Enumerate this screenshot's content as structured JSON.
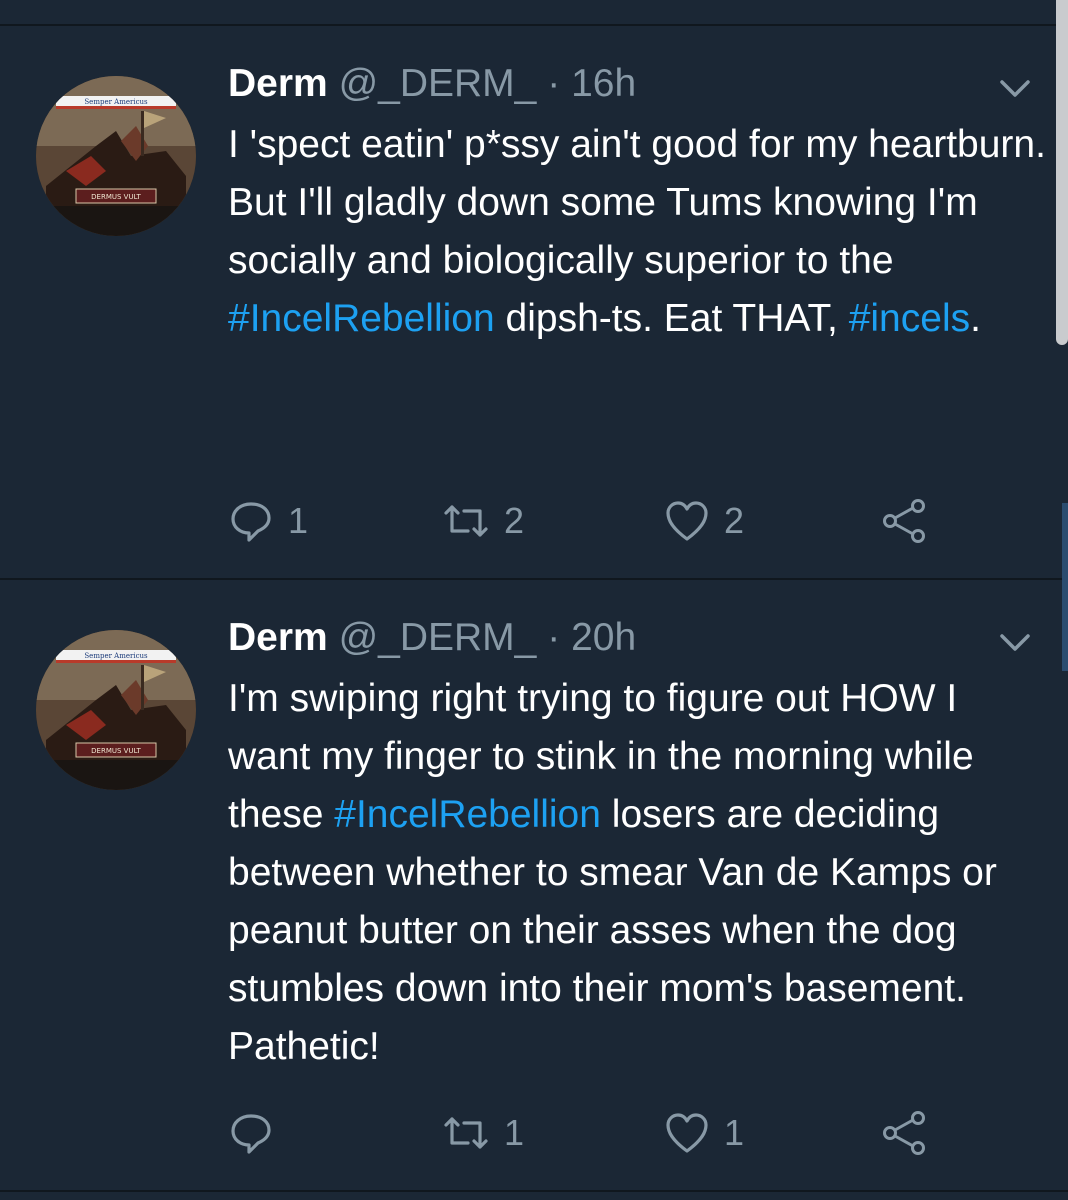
{
  "tweets": [
    {
      "display_name": "Derm",
      "handle": "@_DERM_",
      "separator": "·",
      "time": "16h",
      "avatar": {
        "top_text": "Semper Americus",
        "bottom_text": "DERMUS VULT"
      },
      "text_parts": [
        "I 'spect eatin' p*ssy ain't good for my heartburn. But I'll gladly down some Tums knowing I'm socially and biologically superior to the ",
        "#IncelRebellion",
        " dipsh-ts. Eat THAT, ",
        "#incels",
        "."
      ],
      "reply_count": "1",
      "retweet_count": "2",
      "like_count": "2"
    },
    {
      "display_name": "Derm",
      "handle": "@_DERM_",
      "separator": "·",
      "time": "20h",
      "avatar": {
        "top_text": "Semper Americus",
        "bottom_text": "DERMUS VULT"
      },
      "text_parts": [
        "I'm swiping right trying to figure out HOW I want my finger to stink in the morning while these ",
        "#IncelRebellion",
        " losers are deciding between whether to smear Van de Kamps or peanut butter on their asses when the dog stumbles down into their mom's basement. Pathetic!"
      ],
      "reply_count": "",
      "retweet_count": "1",
      "like_count": "1"
    }
  ],
  "colors": {
    "background": "#1b2735",
    "text": "#ffffff",
    "muted": "#8899a6",
    "hashtag": "#1da1f2"
  },
  "icons": [
    "reply-icon",
    "retweet-icon",
    "like-icon",
    "share-icon",
    "chevron-down-icon"
  ]
}
